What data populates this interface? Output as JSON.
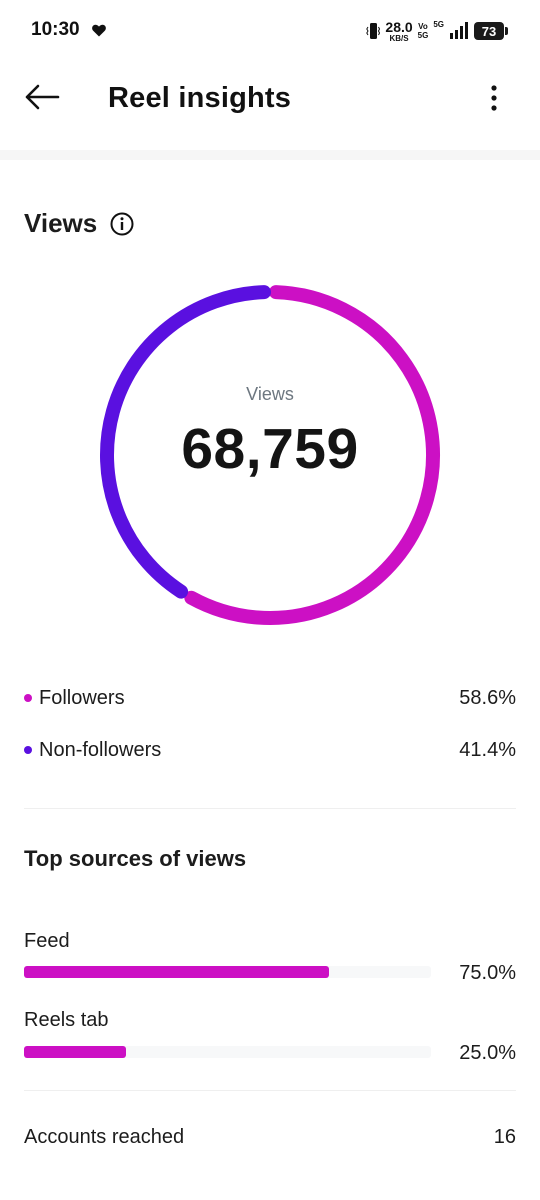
{
  "status_bar": {
    "time": "10:30",
    "net_speed": "28.0",
    "net_speed_unit": "KB/S",
    "volte_top": "Vo",
    "volte_bottom": "5G",
    "network": "5G",
    "battery": "73"
  },
  "header": {
    "title": "Reel insights"
  },
  "views": {
    "section_title": "Views",
    "donut_label": "Views",
    "total": "68,759",
    "legend": [
      {
        "label": "Followers",
        "value": "58.6%",
        "color": "#cc10c4"
      },
      {
        "label": "Non-followers",
        "value": "41.4%",
        "color": "#5a10e0"
      }
    ]
  },
  "chart_data": {
    "type": "pie",
    "categories": [
      "Followers",
      "Non-followers"
    ],
    "values": [
      58.6,
      41.4
    ],
    "colors": [
      "#cc10c4",
      "#5a10e0"
    ],
    "center_label": "Views",
    "center_value": "68,759"
  },
  "sources": {
    "title": "Top sources of views",
    "items": [
      {
        "label": "Feed",
        "value": "75.0%",
        "fraction": 0.75,
        "color": "#cc10c4"
      },
      {
        "label": "Reels tab",
        "value": "25.0%",
        "fraction": 0.25,
        "color": "#cc10c4"
      }
    ]
  },
  "accounts_reached": {
    "label": "Accounts reached",
    "value": "16"
  },
  "icons": {
    "back": "arrow-left-icon",
    "more": "more-vertical-icon",
    "info": "info-icon",
    "heart": "heart-icon",
    "vibrate": "vibrate-icon",
    "signal": "signal-icon"
  }
}
